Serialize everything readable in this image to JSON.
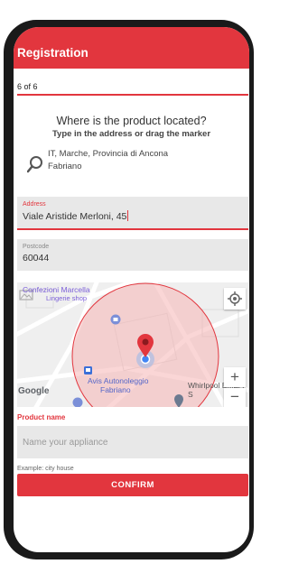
{
  "header": {
    "title": "Registration"
  },
  "progress": {
    "step_text": "6 of 6",
    "current": 6,
    "total": 6
  },
  "location": {
    "question": "Where is the product located?",
    "hint": "Type in the address or drag the marker",
    "result_line1": "IT, Marche, Provincia di Ancona",
    "result_line2": "Fabriano"
  },
  "address": {
    "label": "Address",
    "value": "Viale Aristide Merloni, 45"
  },
  "postcode": {
    "label": "Postcode",
    "value": "60044"
  },
  "map": {
    "places": [
      {
        "name_line1": "Confezioni Marcella",
        "name_line2": "Lingerie shop"
      },
      {
        "name_line1": "Avis Autonoleggio",
        "name_line2": "Fabriano"
      },
      {
        "name_line1": "Whirlpool EMEA S"
      }
    ],
    "attribution": "Google",
    "zoom_in": "+",
    "zoom_out": "−"
  },
  "product": {
    "label": "Product name",
    "placeholder": "Name your appliance",
    "example": "Example: city house"
  },
  "confirm_label": "CONFIRM",
  "colors": {
    "accent": "#e2363e",
    "field_bg": "#e8e8e8",
    "map_radius": "#f5b5b5",
    "marker_blue": "#4285f4"
  }
}
